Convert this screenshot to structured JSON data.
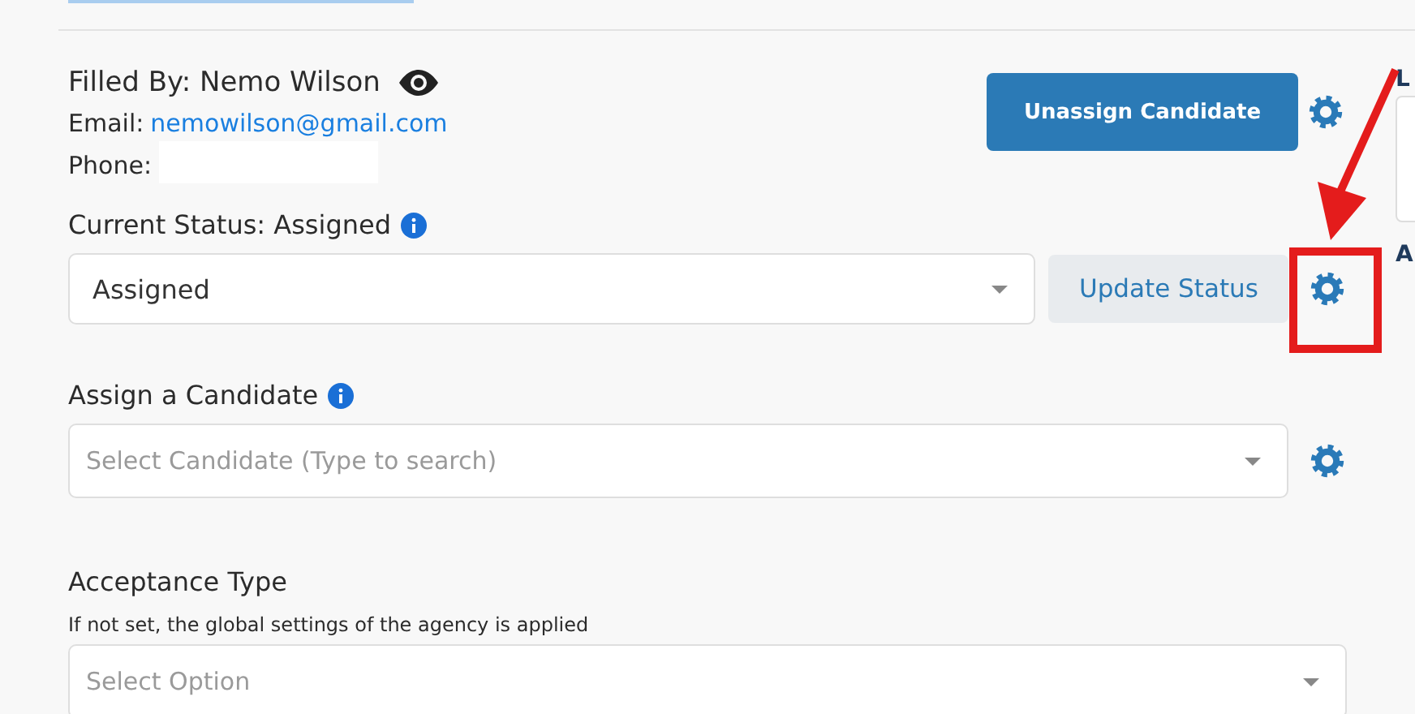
{
  "filled_by": {
    "label": "Filled By:",
    "name": "Nemo Wilson"
  },
  "email": {
    "label": "Email:",
    "value": "nemowilson@gmail.com"
  },
  "phone": {
    "label": "Phone:"
  },
  "unassign_button": "Unassign Candidate",
  "current_status": {
    "label": "Current Status: Assigned",
    "value": "Assigned",
    "button": "Update Status"
  },
  "assign": {
    "label": "Assign a Candidate",
    "placeholder": "Select Candidate (Type to search)"
  },
  "acceptance": {
    "label": "Acceptance Type",
    "hint": "If not set, the global settings of the agency is applied",
    "placeholder": "Select Option"
  },
  "side_labels": [
    "L",
    "A"
  ]
}
